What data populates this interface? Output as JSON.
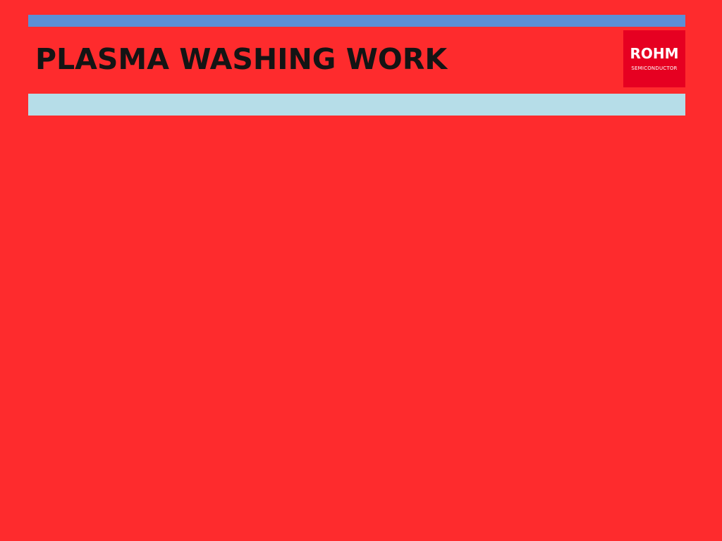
{
  "slide": {
    "title": "PLASMA WASHING WORK",
    "logo_word": "ROHM",
    "logo_sub": "SEMICONDUCTOR"
  },
  "colors": {
    "background": "#fe2b2d",
    "top_rule": "#5b8fd6",
    "sub_band": "#b6dde8",
    "logo_red": "#e60021",
    "title_text": "#141414"
  }
}
